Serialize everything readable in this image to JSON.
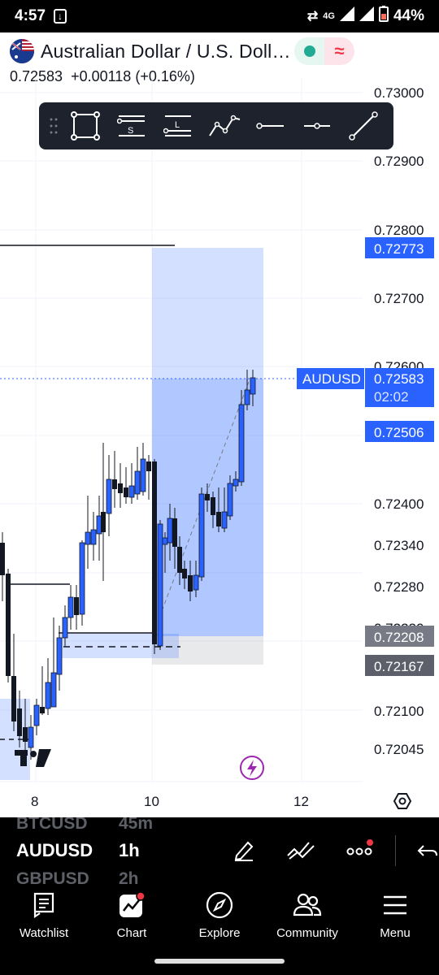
{
  "status_bar": {
    "time": "4:57",
    "network": "4G",
    "battery": "44%"
  },
  "header": {
    "title": "Australian Dollar / U.S. Doll…",
    "price": "0.72583",
    "change": "+0.00118 (+0.16%)"
  },
  "chart": {
    "price_ticks": [
      "0.73000",
      "0.72900",
      "0.72800",
      "0.72700",
      "0.72600",
      "0.72400",
      "0.72340",
      "0.72280",
      "0.72220",
      "0.72100",
      "0.72045"
    ],
    "time_ticks": [
      "8",
      "10",
      "12"
    ],
    "markers": {
      "target": "0.72773",
      "symbol": "AUDUSD",
      "current_price": "0.72583",
      "countdown": "02:02",
      "entry": "0.72506",
      "level_1": "0.72208",
      "level_2": "0.72167"
    },
    "colors": {
      "up_candle": "#2962ff",
      "down_candle": "#000000",
      "projection": "#2962ff",
      "marker_blue": "#2962ff",
      "marker_gray": "#787b86"
    }
  },
  "toolbar": {
    "items": [
      "grip-icon",
      "rectangle-icon",
      "parallel-channel-icon",
      "lines-icon",
      "path-icon",
      "horizontal-line-icon",
      "horizontal-ray-icon",
      "trend-line-icon"
    ]
  },
  "symbols": {
    "prev": "BTCUSD",
    "prev_interval": "45m",
    "current": "AUDUSD",
    "current_interval": "1h",
    "next": "GBPUSD",
    "next_interval": "2h"
  },
  "nav": {
    "items": [
      {
        "label": "Watchlist",
        "icon": "watchlist-icon"
      },
      {
        "label": "Chart",
        "icon": "chart-icon"
      },
      {
        "label": "Explore",
        "icon": "compass-icon"
      },
      {
        "label": "Community",
        "icon": "community-icon"
      },
      {
        "label": "Menu",
        "icon": "menu-icon"
      }
    ]
  }
}
